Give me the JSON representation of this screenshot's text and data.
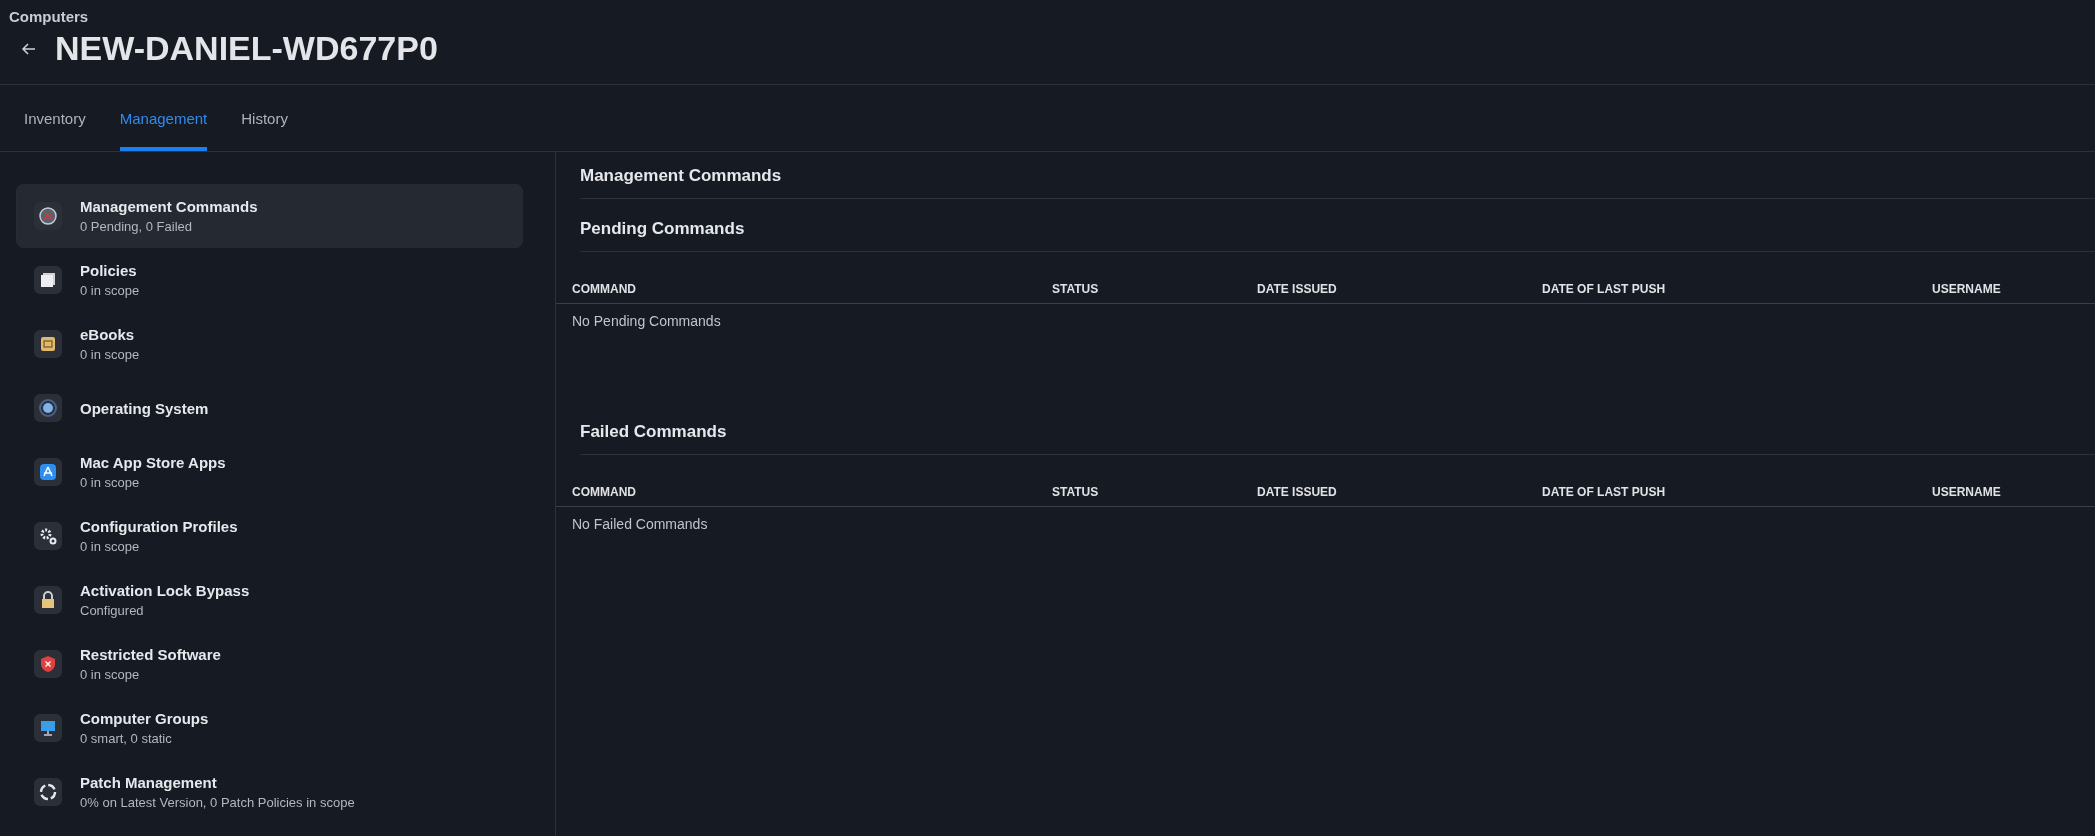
{
  "breadcrumb": "Computers",
  "title": "NEW-DANIEL-WD677P0",
  "tabs": [
    {
      "label": "Inventory",
      "selected": false
    },
    {
      "label": "Management",
      "selected": true
    },
    {
      "label": "History",
      "selected": false
    }
  ],
  "sidebar": {
    "items": [
      {
        "title": "Management Commands",
        "subtitle": "0 Pending, 0 Failed",
        "selected": true
      },
      {
        "title": "Policies",
        "subtitle": "0 in scope",
        "selected": false
      },
      {
        "title": "eBooks",
        "subtitle": "0 in scope",
        "selected": false
      },
      {
        "title": "Operating System",
        "selected": false
      },
      {
        "title": "Mac App Store Apps",
        "subtitle": "0 in scope",
        "selected": false
      },
      {
        "title": "Configuration Profiles",
        "subtitle": "0 in scope",
        "selected": false
      },
      {
        "title": "Activation Lock Bypass",
        "subtitle": "Configured",
        "selected": false
      },
      {
        "title": "Restricted Software",
        "subtitle": "0 in scope",
        "selected": false
      },
      {
        "title": "Computer Groups",
        "subtitle": "0 smart, 0 static",
        "selected": false
      },
      {
        "title": "Patch Management",
        "subtitle": "0% on Latest Version, 0 Patch Policies in scope",
        "selected": false
      }
    ]
  },
  "main": {
    "heading": "Management Commands",
    "sections": [
      {
        "title": "Pending Commands",
        "columns": [
          "COMMAND",
          "STATUS",
          "DATE ISSUED",
          "DATE OF LAST PUSH",
          "USERNAME"
        ],
        "empty_text": "No Pending Commands"
      },
      {
        "title": "Failed Commands",
        "columns": [
          "COMMAND",
          "STATUS",
          "DATE ISSUED",
          "DATE OF LAST PUSH",
          "USERNAME"
        ],
        "empty_text": "No Failed Commands"
      }
    ]
  }
}
